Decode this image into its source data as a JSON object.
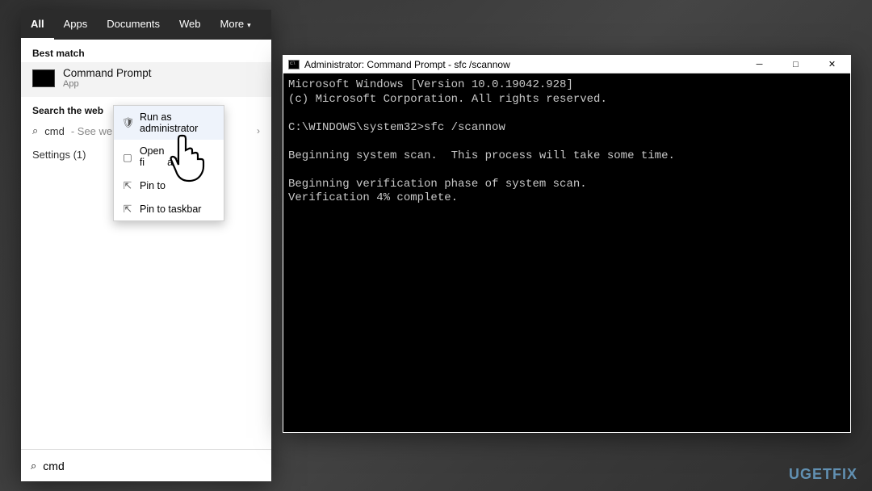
{
  "tabs": {
    "all": "All",
    "apps": "Apps",
    "documents": "Documents",
    "web": "Web",
    "more": "More"
  },
  "best_match": {
    "header": "Best match",
    "title": "Command Prompt",
    "subtitle": "App"
  },
  "search_web": {
    "header": "Search the web",
    "query": "cmd",
    "suffix": " - See we"
  },
  "settings": {
    "label": "Settings (1)"
  },
  "search_input": {
    "value": "cmd"
  },
  "context_menu": {
    "run_admin": "Run as administrator",
    "open_loc": "Open fi",
    "open_loc_tail": "ation",
    "pin_start": "Pin to",
    "pin_taskbar": "Pin to taskbar"
  },
  "cmd": {
    "title": "Administrator: Command Prompt - sfc  /scannow",
    "lines": [
      "Microsoft Windows [Version 10.0.19042.928]",
      "(c) Microsoft Corporation. All rights reserved.",
      "",
      "C:\\WINDOWS\\system32>sfc /scannow",
      "",
      "Beginning system scan.  This process will take some time.",
      "",
      "Beginning verification phase of system scan.",
      "Verification 4% complete."
    ]
  },
  "watermark": "UGETFIX"
}
